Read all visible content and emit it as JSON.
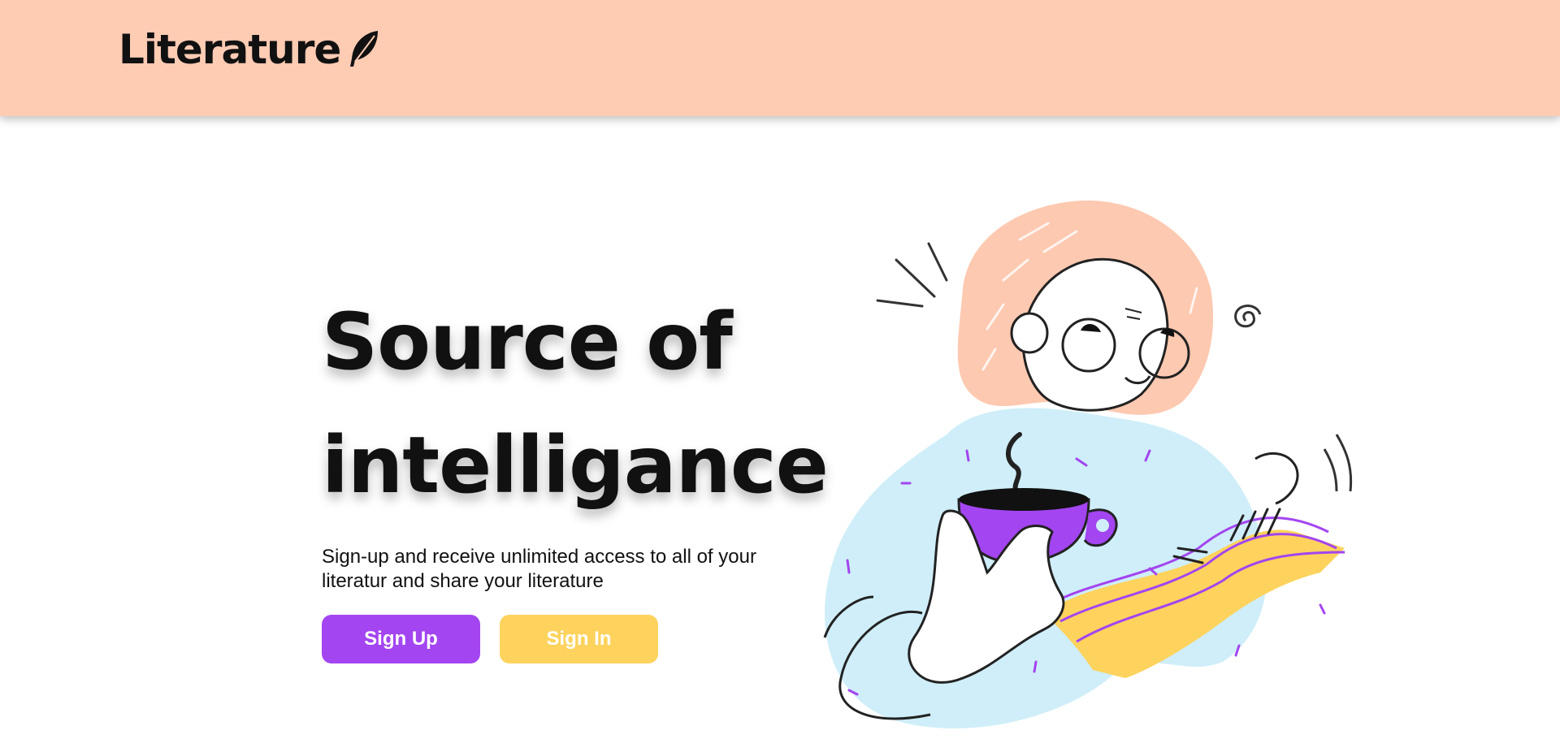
{
  "navbar": {
    "brand": "Literature",
    "brand_icon": "feather-icon"
  },
  "hero": {
    "title_line1": "Source of",
    "title_line2": "intelligance",
    "description": "Sign-up and receive unlimited access to all of your literatur and share your literature",
    "signup_label": "Sign Up",
    "signin_label": "Sign In"
  },
  "colors": {
    "navbar_bg": "#fecbb3",
    "primary": "#a345f0",
    "secondary": "#fdd35d",
    "illustration_blob": "#cfeef9",
    "hair": "#fec9b1"
  }
}
